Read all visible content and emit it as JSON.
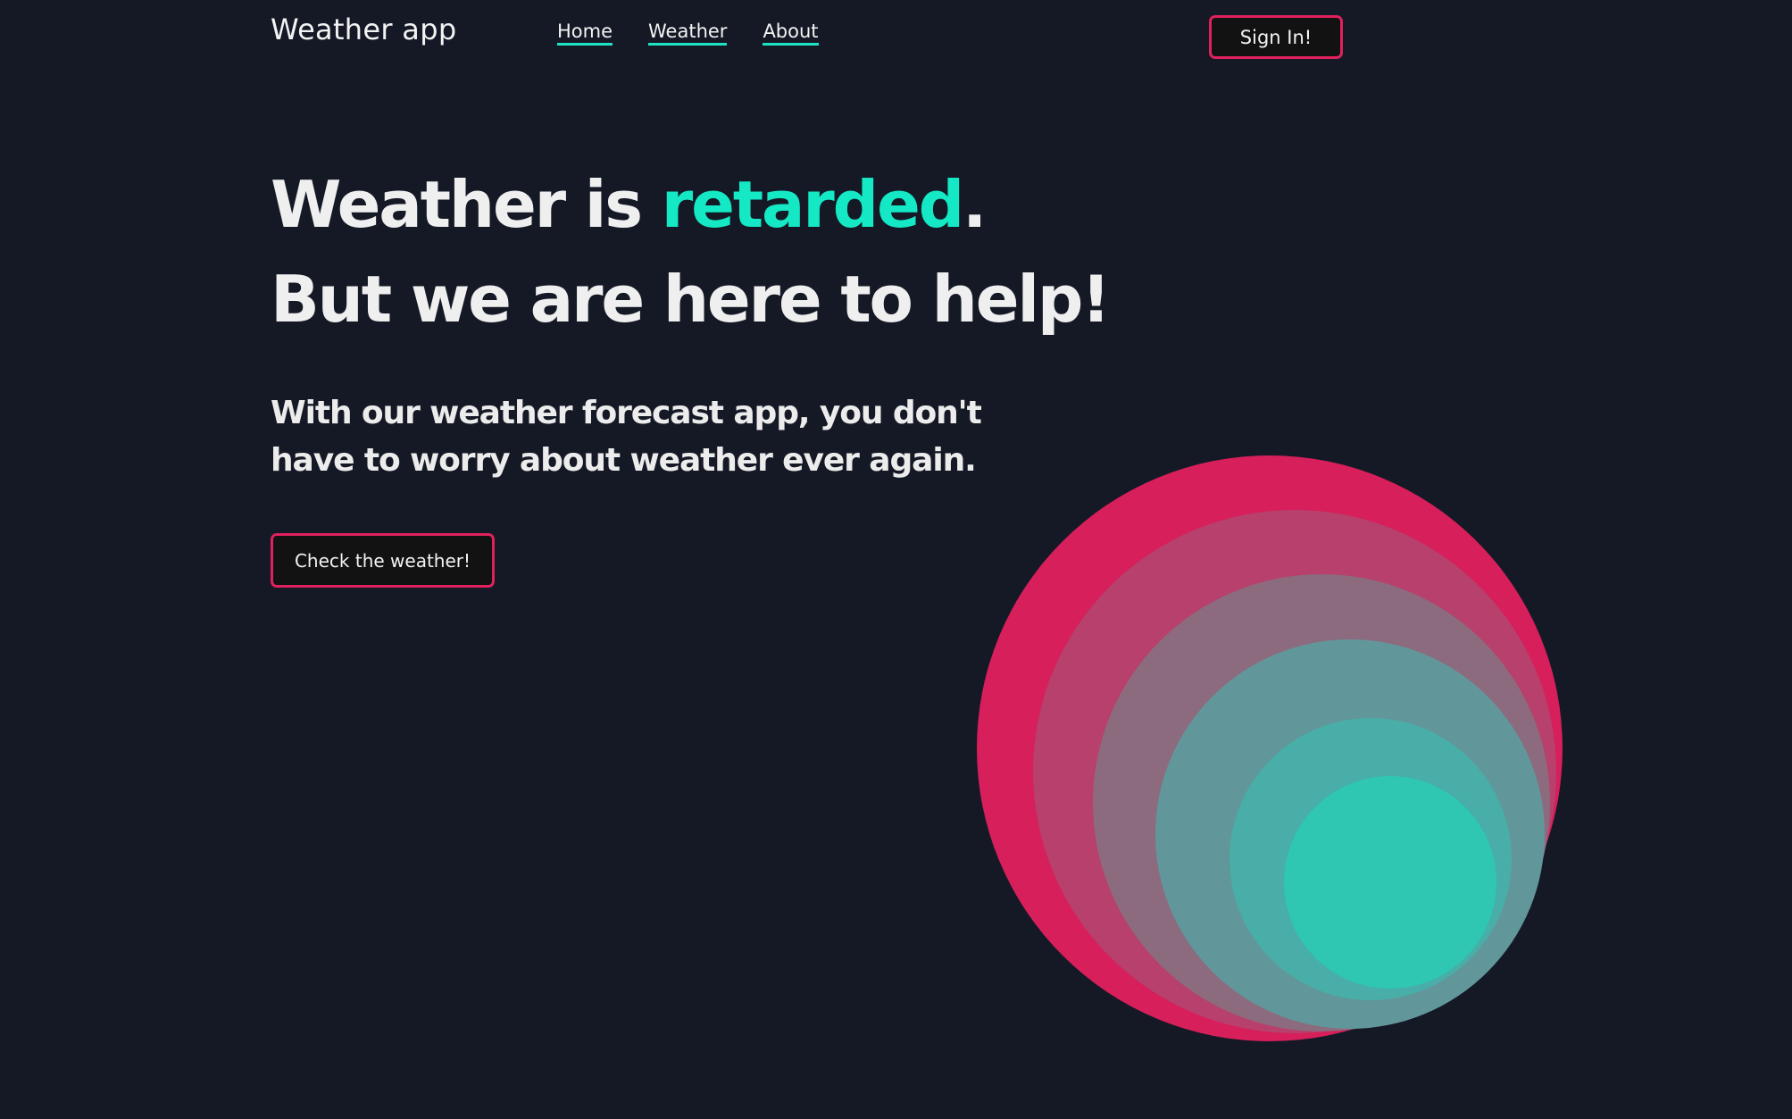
{
  "header": {
    "logo": "Weather app",
    "nav": [
      "Home",
      "Weather",
      "About"
    ],
    "signin_label": "Sign In!"
  },
  "hero": {
    "line1_start": "Weather is ",
    "line1_accent": "retarded",
    "line1_end": ".",
    "line2": "But we are here to help!",
    "tagline": "With our weather forecast app, you don't have to worry about weather ever again.",
    "cta_label": "Check the weather!"
  },
  "colors": {
    "background": "#141925",
    "accent_teal": "#14e8c5",
    "accent_pink": "#e0215e",
    "text": "#efefef"
  }
}
